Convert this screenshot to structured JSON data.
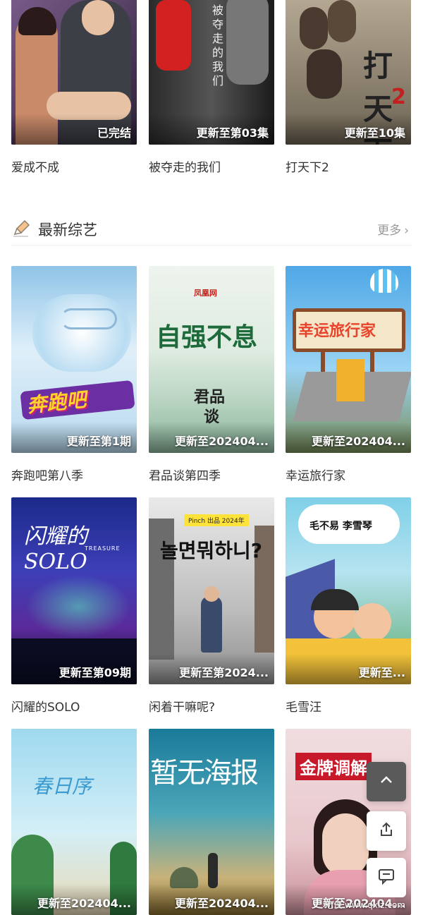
{
  "row0": [
    {
      "title": "爱成不成",
      "status": "已完结"
    },
    {
      "title": "被夺走的我们",
      "status": "更新至第03集"
    },
    {
      "title": "打天下2",
      "status": "更新至10集"
    }
  ],
  "section": {
    "title": "最新综艺",
    "more_label": "更多",
    "icon": "pen-icon"
  },
  "row1": [
    {
      "title": "奔跑吧第八季",
      "status": "更新至第1期"
    },
    {
      "title": "君品谈第四季",
      "status": "更新至202404..."
    },
    {
      "title": "幸运旅行家",
      "status": "更新至202404..."
    }
  ],
  "row2": [
    {
      "title": "闪耀的SOLO",
      "status": "更新至第09期"
    },
    {
      "title": "闲着干嘛呢?",
      "status": "更新至第2024..."
    },
    {
      "title": "毛雪汪",
      "status": "更新至..."
    }
  ],
  "row3": [
    {
      "title": "",
      "status": "更新至202404..."
    },
    {
      "title": "",
      "status": "更新至202404..."
    },
    {
      "title": "",
      "status": "更新至202404..."
    }
  ],
  "poster_text": {
    "p1_0": "被夺走的我们",
    "p3_text": "打天下",
    "p3_num": "2",
    "p4_logo": "奔跑吧",
    "p5_brand": "凤凰网",
    "p5_main": "自强不息",
    "p5_sub1": "君品",
    "p5_sub2": "谈",
    "p6_sign": "幸运旅行家",
    "p7_main": "闪耀的SOLO",
    "p7_sub": "TREASURE",
    "p8_tag": "Pinch 出品 2024年",
    "p8_main": "놀면뭐하니?",
    "p9_names": "毛不易 李雪琴",
    "p10_main": "春日序",
    "p11_main": "暂无海报",
    "p12_title": "金牌调解"
  },
  "colors": {
    "accent": "#e05a1c",
    "text": "#333333",
    "muted": "#999999"
  },
  "watermark": "七侠 www.qxlz.com",
  "fab": {
    "up": "chevron-up-icon",
    "share": "share-icon",
    "comment": "comment-icon"
  }
}
